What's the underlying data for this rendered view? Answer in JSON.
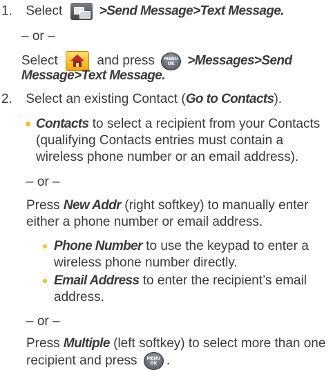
{
  "step1": {
    "number": "1.",
    "select": "Select",
    "path": ">Send Message>Text Message.",
    "or": "– or –",
    "select2": "Select",
    "and_press": "and press",
    "path2_a": ">Messages>Send",
    "path2_b": "Message>Text Message."
  },
  "step2": {
    "number": "2.",
    "text_a": "Select an existing Contact (",
    "goto": "Go to Contacts",
    "text_b": ").",
    "contacts_term": "Contacts",
    "contacts_l1": " to select a recipient from your Contacts",
    "contacts_l2": "(qualifying Contacts entries must contain a",
    "contacts_l3": "wireless phone number or an email address).",
    "or1": "– or –",
    "press": "Press ",
    "newaddr": "New Addr",
    "newaddr_rest": " (right softkey) to manually enter",
    "newaddr_l2": "either a phone number or email address.",
    "phone_term": "Phone Number",
    "phone_l1": " to use the keypad to enter a",
    "phone_l2": "wireless phone number directly.",
    "email_term": "Email Address",
    "email_l1": " to enter the recipient’s email",
    "email_l2": "address.",
    "or2": "– or –",
    "press2": "Press ",
    "multiple": "Multiple",
    "multiple_rest": " (left softkey) to select more than one",
    "last_line": "recipient and press",
    "last_end": "."
  },
  "icons": {
    "msg_icon": "message-icon",
    "home_icon": "home-icon",
    "menu_key": "menu-ok-key-icon",
    "menu_top": "MENU",
    "menu_bottom": "OK"
  }
}
